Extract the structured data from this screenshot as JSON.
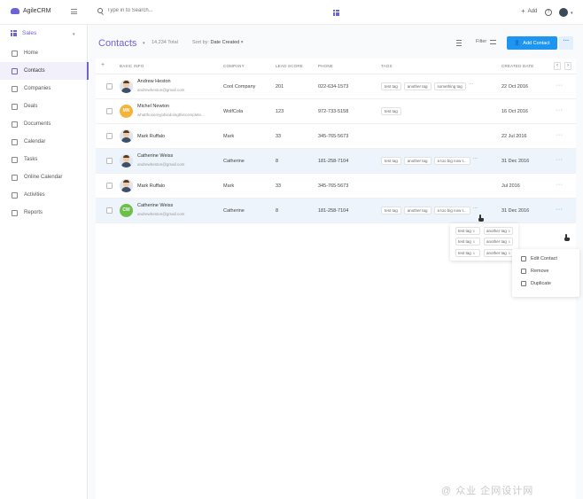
{
  "app": {
    "name": "AgileCRM"
  },
  "search": {
    "placeholder": "Type in to Search..."
  },
  "topbar": {
    "add_label": "Add",
    "help_glyph": "?"
  },
  "sidebar": {
    "module": "Sales",
    "items": [
      {
        "label": "Home",
        "icon": "home-icon",
        "active": false
      },
      {
        "label": "Contacts",
        "icon": "contacts-icon",
        "active": true
      },
      {
        "label": "Companies",
        "icon": "companies-icon",
        "active": false
      },
      {
        "label": "Deals",
        "icon": "deals-icon",
        "active": false
      },
      {
        "label": "Documents",
        "icon": "documents-icon",
        "active": false
      },
      {
        "label": "Calendar",
        "icon": "calendar-icon",
        "active": false
      },
      {
        "label": "Tasks",
        "icon": "tasks-icon",
        "active": false
      },
      {
        "label": "Online Calendar",
        "icon": "online-calendar-icon",
        "active": false
      },
      {
        "label": "Activities",
        "icon": "activities-icon",
        "active": false
      },
      {
        "label": "Reports",
        "icon": "reports-icon",
        "active": false
      }
    ]
  },
  "page": {
    "title": "Contacts",
    "total": "14,234 Total",
    "sort_prefix": "Sort by:",
    "sort_value": "Date Created",
    "filter_label": "Filter",
    "add_contact_label": "Add Contact",
    "more_glyph": "···"
  },
  "table": {
    "headers": {
      "basic_info": "BASIC INFO",
      "company": "COMPANY",
      "lead_score": "LEAD SCORE",
      "phone": "PHONE",
      "tags": "TAGS",
      "created_date": "CREATED DATE"
    },
    "rows": [
      {
        "initials": "",
        "avatar_color": "#3d5068",
        "photo": true,
        "name": "Andrew Heston",
        "email": "andrewheston@gmail.com",
        "company": "Cool Company",
        "score": "201",
        "phone": "022-634-1573",
        "tags": [
          "test tag",
          "another tag",
          "something tag"
        ],
        "more": true,
        "date": "22 Oct 2016"
      },
      {
        "initials": "MN",
        "avatar_color": "#f4b43a",
        "photo": false,
        "name": "Michel Newton",
        "email": "whatthosemyjobisdoingthiscomplete...",
        "company": "WolfCola",
        "score": "123",
        "phone": "972-733-5158",
        "tags": [
          "test tag"
        ],
        "more": false,
        "date": "16 Oct 2016"
      },
      {
        "initials": "",
        "avatar_color": "#3d5068",
        "photo": true,
        "name": "Mark Ruffalo",
        "email": "",
        "company": "Mark",
        "score": "33",
        "phone": "345-765-5673",
        "tags": [],
        "more": false,
        "date": "22 Jul 2016"
      },
      {
        "initials": "",
        "avatar_color": "#3d5068",
        "photo": true,
        "name": "Catherine Weiss",
        "email": "andrewheston@gmail.com",
        "company": "Catherine",
        "score": "8",
        "phone": "181-258-7104",
        "tags": [
          "test tag",
          "another tag",
          "a too big now t..."
        ],
        "more": true,
        "date": "31 Dec 2016"
      },
      {
        "initials": "",
        "avatar_color": "#3d5068",
        "photo": true,
        "name": "Mark Ruffalo",
        "email": "",
        "company": "Mark",
        "score": "33",
        "phone": "345-765-5673",
        "tags": [],
        "more": false,
        "date": "Jul 2016"
      },
      {
        "initials": "CW",
        "avatar_color": "#6cc04a",
        "photo": false,
        "name": "Catherine Weiss",
        "email": "andrewheston@gmail.com",
        "company": "Catherine",
        "score": "8",
        "phone": "181-258-7104",
        "tags": [
          "test tag",
          "another tag",
          "a too big now t..."
        ],
        "more": true,
        "date": "31 Dec 2016"
      }
    ]
  },
  "tag_popover": {
    "tags": [
      "test tag",
      "another tag",
      "test tag",
      "another tag",
      "test tag",
      "another tag"
    ],
    "remove_glyph": "x"
  },
  "row_menu": {
    "items": [
      {
        "label": "Edit Contact",
        "icon": "pencil-icon"
      },
      {
        "label": "Remove",
        "icon": "trash-icon"
      },
      {
        "label": "Duplicate",
        "icon": "duplicate-icon"
      }
    ]
  },
  "colors": {
    "accent": "#6c63d8",
    "primary_button": "#1e96f0",
    "highlight_row": "#eef4fb"
  },
  "watermark": "@ 众业 企网设计网"
}
